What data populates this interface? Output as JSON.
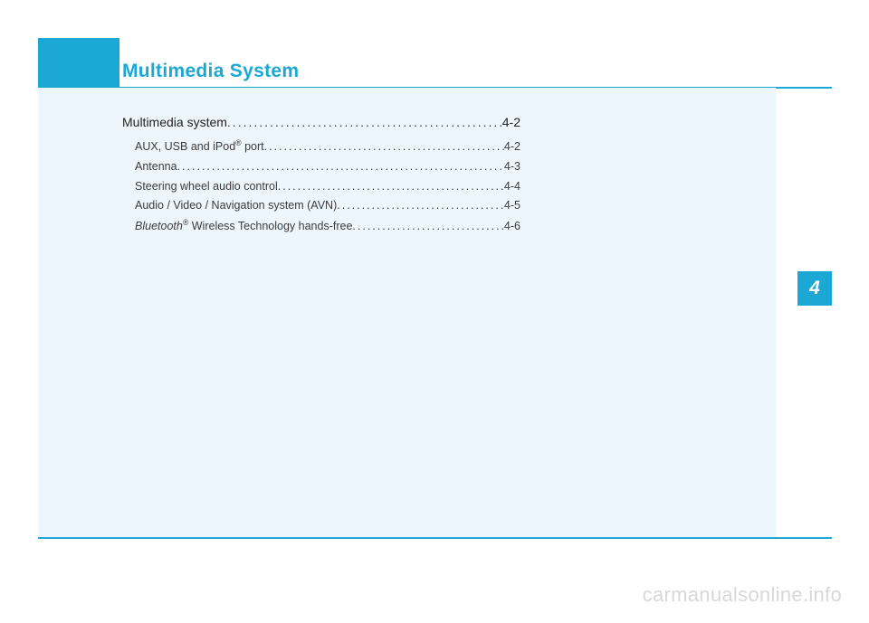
{
  "chapter": {
    "title": "Multimedia System",
    "tab_number": "4"
  },
  "toc": {
    "heading": {
      "label": "Multimedia system",
      "page": "4-2"
    },
    "items": [
      {
        "label_pre": "AUX, USB and iPod",
        "label_sup": "®",
        "label_post": " port",
        "page": "4-2"
      },
      {
        "label_pre": "Antenna",
        "label_sup": "",
        "label_post": "",
        "page": "4-3"
      },
      {
        "label_pre": "Steering wheel audio control",
        "label_sup": "",
        "label_post": "",
        "page": "4-4"
      },
      {
        "label_pre": "Audio / Video / Navigation system (AVN)",
        "label_sup": "",
        "label_post": "",
        "page": "4-5"
      },
      {
        "label_italic": "Bluetooth",
        "label_sup": "®",
        "label_post": " Wireless Technology hands-free",
        "page": "4-6"
      }
    ]
  },
  "watermark": "carmanualsonline.info"
}
